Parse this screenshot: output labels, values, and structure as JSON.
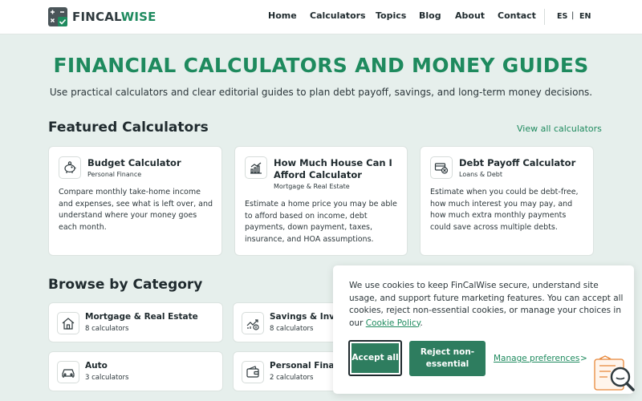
{
  "header": {
    "logo": {
      "part1": "FINCAL",
      "part2": "WISE"
    },
    "nav": [
      "Home",
      "Calculators",
      "Topics",
      "Blog",
      "About",
      "Contact"
    ],
    "languages": [
      "ES",
      "EN"
    ],
    "lang_separator": "|"
  },
  "hero": {
    "title": "FINANCIAL CALCULATORS AND MONEY GUIDES",
    "subtitle": "Use practical calculators and clear editorial guides to plan debt payoff, savings, and long-term money decisions."
  },
  "featured": {
    "title": "Featured Calculators",
    "view_all": "View all calculators",
    "cards": [
      {
        "icon": "piggy-bank-icon",
        "title": "Budget Calculator",
        "category": "Personal Finance",
        "description": "Compare monthly take-home income and expenses, see what is left over, and understand where your money goes each month."
      },
      {
        "icon": "chart-growth-icon",
        "title": "How Much House Can I Afford Calculator",
        "category": "Mortgage & Real Estate",
        "description": "Estimate a home price you may be able to afford based on income, debt payments, down payment, taxes, insurance, and HOA assumptions."
      },
      {
        "icon": "card-payoff-icon",
        "title": "Debt Payoff Calculator",
        "category": "Loans & Debt",
        "description": "Estimate when you could be debt-free, how much interest you may pay, and how much extra monthly payments could save across multiple debts."
      }
    ]
  },
  "browse": {
    "title": "Browse by Category",
    "categories": [
      {
        "icon": "house-icon",
        "name": "Mortgage & Real Estate",
        "count": "8 calculators"
      },
      {
        "icon": "investment-chart-icon",
        "name": "Savings & Inv",
        "count": "8 calculators"
      },
      {
        "icon": "car-icon",
        "name": "Auto",
        "count": "3 calculators"
      },
      {
        "icon": "wallet-icon",
        "name": "Personal Fina",
        "count": "2 calculators"
      }
    ]
  },
  "cookie": {
    "text": "We use cookies to keep FinCalWise secure, understand site usage, and support future marketing features. You can accept all cookies, reject non-essential cookies, or manage your choices in our ",
    "policy_link": "Cookie Policy",
    "text_end": ".",
    "accept": "Accept all",
    "reject": "Reject non-essential",
    "manage": "Manage preferences",
    "manage_chevron": ">"
  },
  "colors": {
    "brand_green": "#1e8a5e",
    "button_green": "#2e7d5f",
    "page_bg": "#e6efec",
    "accent_orange": "#e8883a"
  }
}
